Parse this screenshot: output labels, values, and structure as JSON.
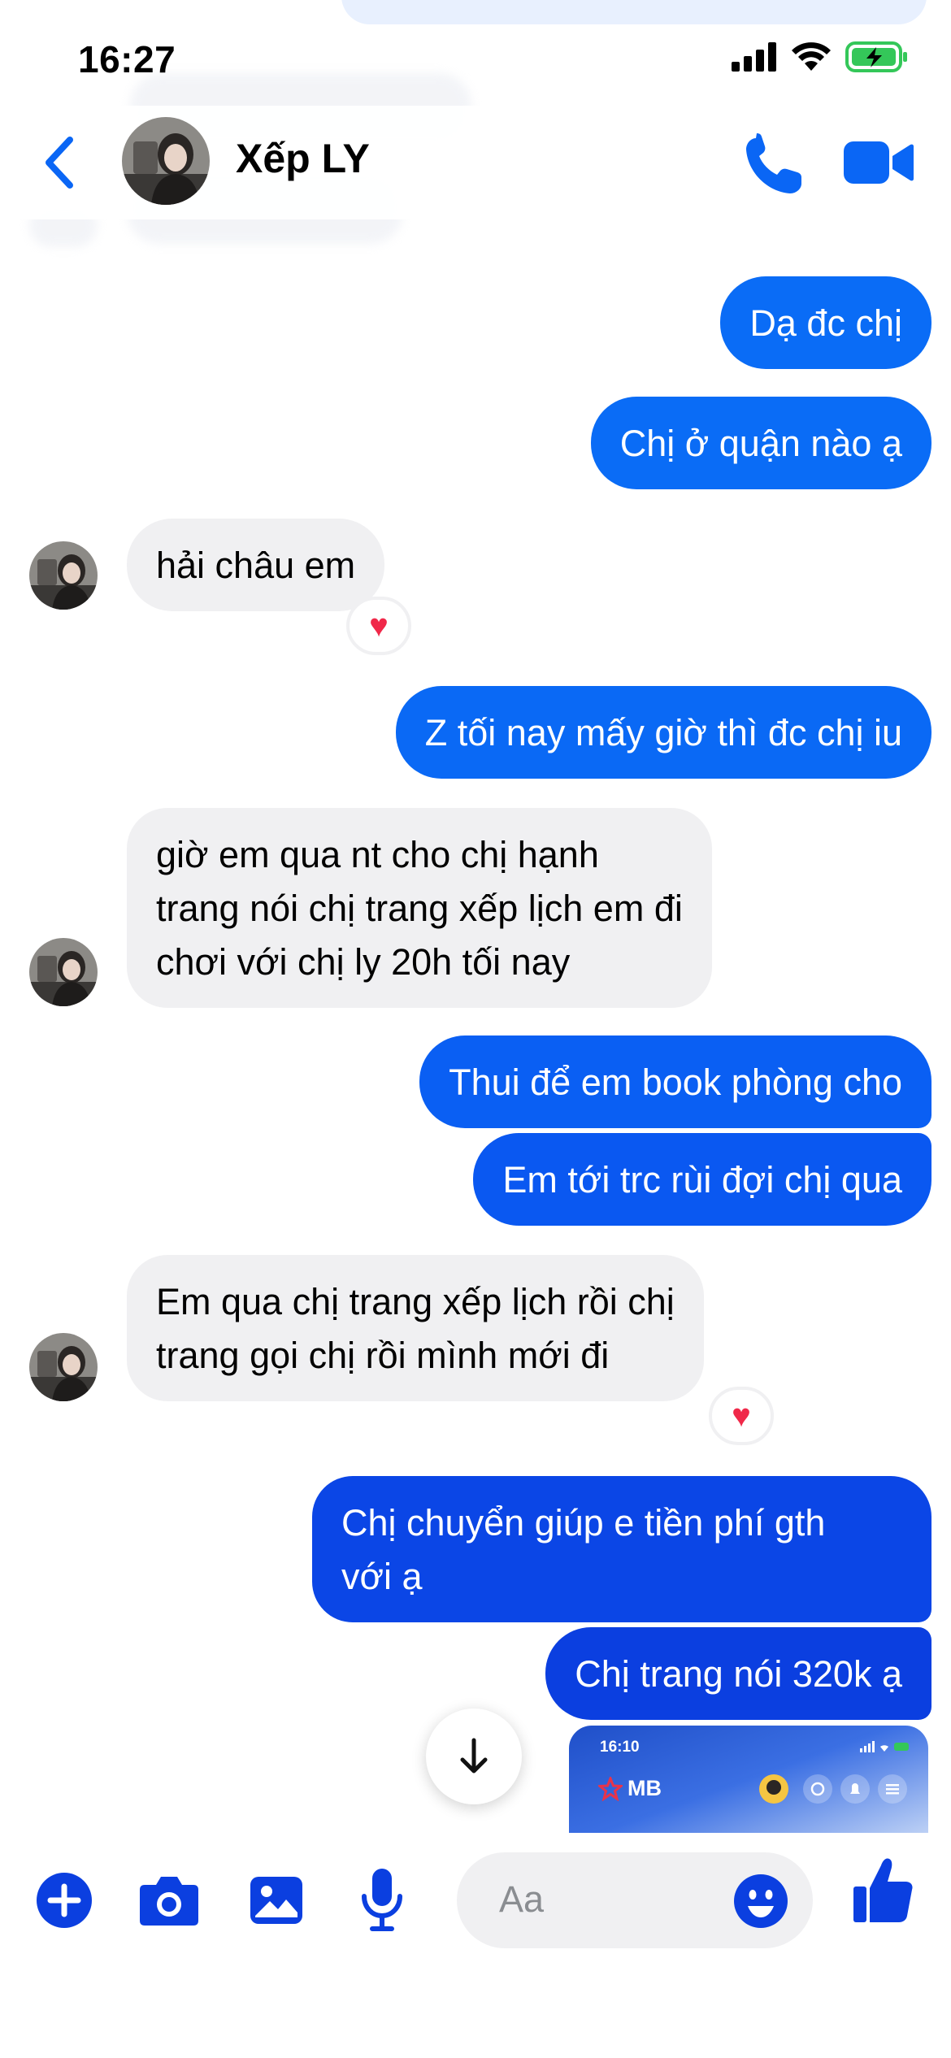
{
  "status_bar": {
    "time": "16:27"
  },
  "header": {
    "contact_name": "Xếp LY"
  },
  "messages": [
    {
      "text": "Dạ đc chị"
    },
    {
      "text": "Chị ở quận nào ạ"
    },
    {
      "text": "hải châu em"
    },
    {
      "text": "Z tối nay mấy giờ thì đc chị iu"
    },
    {
      "lines": [
        "giờ em qua nt cho chị hạnh",
        "trang nói chị trang xếp lịch em đi",
        "chơi với chị ly 20h tối nay"
      ]
    },
    {
      "text": "Thui để em book phòng cho"
    },
    {
      "text": "Em tới trc rùi đợi chị qua"
    },
    {
      "lines": [
        "Em qua chị trang xếp lịch rồi chị",
        "trang gọi chị rồi mình mới đi"
      ]
    },
    {
      "lines": [
        "Chị chuyển giúp e tiền phí gth",
        "với ạ"
      ]
    },
    {
      "text": "Chị trang nói 320k ạ"
    }
  ],
  "reactions": {
    "heart": "♥"
  },
  "image_preview": {
    "time": "16:10",
    "bank_label": "MB"
  },
  "composer": {
    "placeholder": "Aa"
  },
  "colors": {
    "accent": "#0a66f5",
    "bubble_blue_top": "#0a6cf6",
    "bubble_blue_deep": "#0b3fe0",
    "bubble_incoming": "#f0f0f2",
    "heart": "#f02849"
  },
  "icons": [
    "back-chevron-icon",
    "phone-icon",
    "video-camera-icon",
    "plus-icon",
    "camera-icon",
    "gallery-icon",
    "microphone-icon",
    "emoji-icon",
    "thumbs-up-icon",
    "arrow-down-icon"
  ]
}
